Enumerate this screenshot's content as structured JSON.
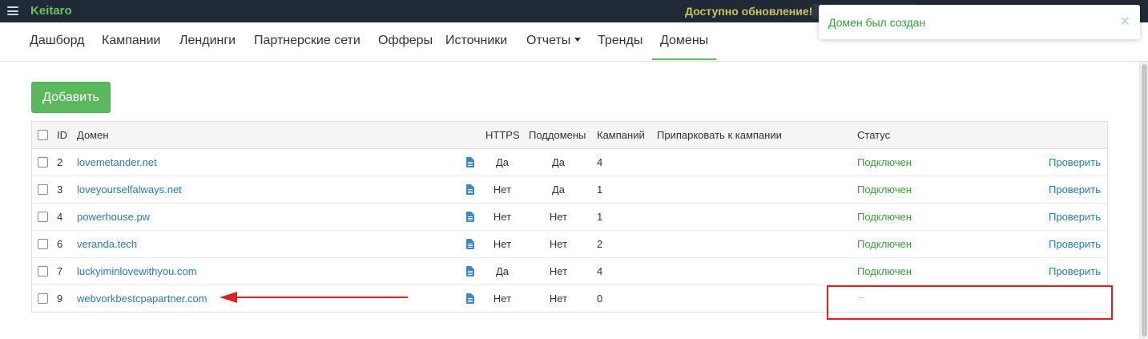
{
  "topbar": {
    "brand": "Keitaro",
    "update_notice": "Доступно обновление!"
  },
  "nav": {
    "items": [
      {
        "label": "Дашборд"
      },
      {
        "label": "Кампании"
      },
      {
        "label": "Лендинги"
      },
      {
        "label": "Партнерские сети"
      },
      {
        "label": "Офферы"
      },
      {
        "label": "Источники"
      },
      {
        "label": "Отчеты"
      },
      {
        "label": "Тренды"
      },
      {
        "label": "Домены"
      }
    ],
    "active": "Домены"
  },
  "toolbar": {
    "add_label": "Добавить"
  },
  "table": {
    "headers": {
      "id": "ID",
      "domain": "Домен",
      "https": "HTTPS",
      "subdomains": "Поддомены",
      "campaigns": "Кампаний",
      "park": "Припарковать к кампании",
      "status": "Статус"
    },
    "rows": [
      {
        "id": "2",
        "domain": "lovemetander.net",
        "https": "Да",
        "subdomains": "Да",
        "campaigns": "4",
        "status": "Подключен",
        "action": "Проверить"
      },
      {
        "id": "3",
        "domain": "loveyourselfalways.net",
        "https": "Нет",
        "subdomains": "Да",
        "campaigns": "1",
        "status": "Подключен",
        "action": "Проверить"
      },
      {
        "id": "4",
        "domain": "powerhouse.pw",
        "https": "Нет",
        "subdomains": "Нет",
        "campaigns": "1",
        "status": "Подключен",
        "action": "Проверить"
      },
      {
        "id": "6",
        "domain": "veranda.tech",
        "https": "Нет",
        "subdomains": "Нет",
        "campaigns": "2",
        "status": "Подключен",
        "action": "Проверить"
      },
      {
        "id": "7",
        "domain": "luckyiminlovewithyou.com",
        "https": "Да",
        "subdomains": "Нет",
        "campaigns": "4",
        "status": "Подключен",
        "action": "Проверить"
      },
      {
        "id": "9",
        "domain": "webvorkbestcpapartner.com",
        "https": "Нет",
        "subdomains": "Нет",
        "campaigns": "0",
        "status": "",
        "action": ""
      }
    ]
  },
  "toast": {
    "message": "Домен был создан",
    "close": "✕"
  },
  "colors": {
    "topbar": "#1f2a36",
    "brand": "#6cc05a",
    "accent_green": "#5cb85c",
    "link": "#2a7ab0",
    "annotation_red": "#e02020"
  }
}
